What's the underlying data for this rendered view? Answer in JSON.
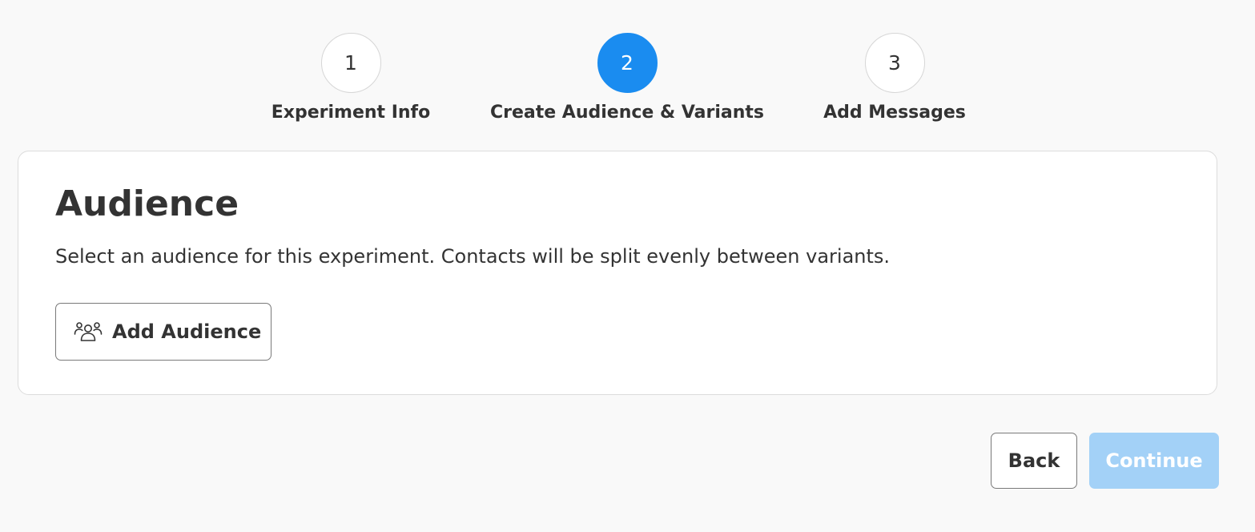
{
  "stepper": {
    "steps": [
      {
        "number": "1",
        "label": "Experiment Info",
        "state": "default"
      },
      {
        "number": "2",
        "label": "Create Audience & Variants",
        "state": "active"
      },
      {
        "number": "3",
        "label": "Add Messages",
        "state": "default"
      }
    ],
    "active_color": "#1a8cf0"
  },
  "audience": {
    "title": "Audience",
    "description": "Select an audience for this experiment. Contacts will be split evenly between variants.",
    "add_button": {
      "icon": "users-icon",
      "label": "Add Audience"
    }
  },
  "footer": {
    "back_label": "Back",
    "continue_label": "Continue",
    "continue_color": "#a3d1f7"
  }
}
